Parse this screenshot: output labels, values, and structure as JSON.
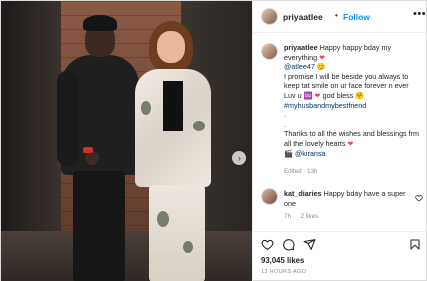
{
  "post": {
    "username": "priyaatlee",
    "separator": "•",
    "follow_label": "Follow",
    "more_label": "•••",
    "next_label": "›"
  },
  "caption": {
    "username": "priyaatlee",
    "line1": "Happy happy bday my everything",
    "mention": "@atlee47",
    "line2": "I promise I will be beside you always to keep tat smile on ur face forever n ever",
    "line3a": "Luv u",
    "line3b": "god bless",
    "hashtag": "#myhusbandmybestfriend",
    "dot1": ".",
    "dot2": ".",
    "line4": "Thanks to all the wishes and blessings frm all the lovely hearts",
    "mention2": "@kiransa",
    "edited": "Edited · 13h"
  },
  "comment": {
    "username": "kat_diaries",
    "text": "Happy bday have a super one",
    "age": "7h",
    "likes": "2 likes"
  },
  "footer": {
    "likes": "93,045 likes",
    "time": "13 HOURS AGO"
  },
  "icons": [
    "heart-icon",
    "comment-icon",
    "share-icon",
    "bookmark-icon",
    "more-icon",
    "chevron-right-icon"
  ],
  "colors": {
    "link": "#0095f6",
    "muted": "#8e8e8e",
    "text": "#262626",
    "heart": "#ed4956"
  }
}
